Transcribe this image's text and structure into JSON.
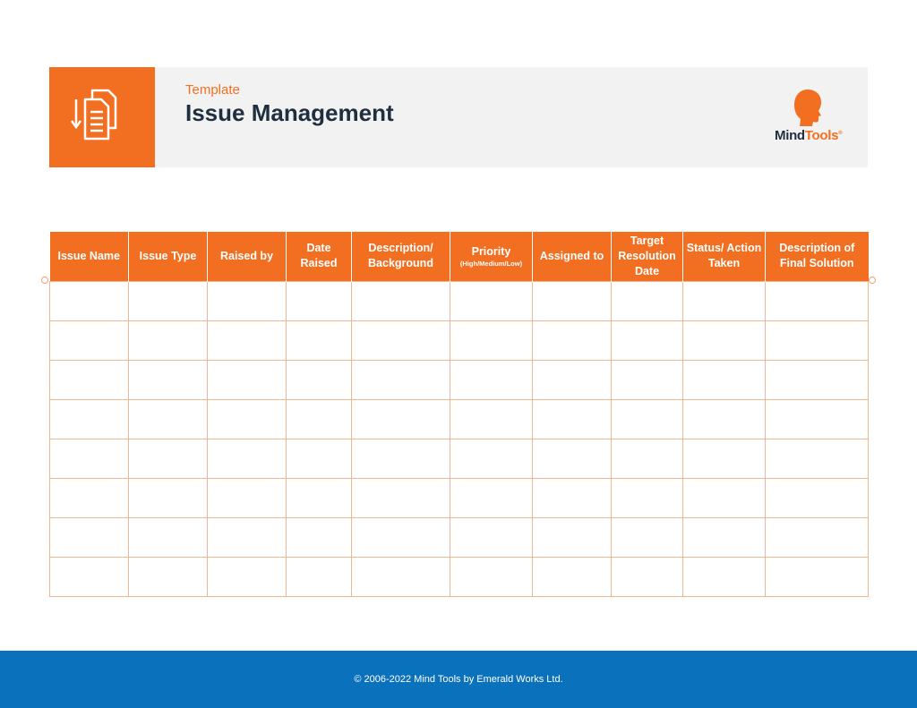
{
  "header": {
    "subtitle": "Template",
    "title": "Issue Management",
    "logo_mind": "Mind",
    "logo_tools": "Tools",
    "logo_mark": "®",
    "icon": "documents-icon"
  },
  "table": {
    "columns": [
      {
        "label": "Issue Name",
        "sub": ""
      },
      {
        "label": "Issue Type",
        "sub": ""
      },
      {
        "label": "Raised by",
        "sub": ""
      },
      {
        "label": "Date Raised",
        "sub": ""
      },
      {
        "label": "Description/ Background",
        "sub": ""
      },
      {
        "label": "Priority",
        "sub": "(High/Medium/Low)"
      },
      {
        "label": "Assigned to",
        "sub": ""
      },
      {
        "label": "Target Resolution Date",
        "sub": ""
      },
      {
        "label": "Status/ Action Taken",
        "sub": ""
      },
      {
        "label": "Description of Final Solution",
        "sub": ""
      }
    ],
    "row_count": 8
  },
  "footer": {
    "copyright": "© 2006-2022 Mind Tools by Emerald Works Ltd."
  },
  "colors": {
    "accent": "#f26f21",
    "footer": "#0a71bc",
    "title": "#1f2f3f"
  }
}
